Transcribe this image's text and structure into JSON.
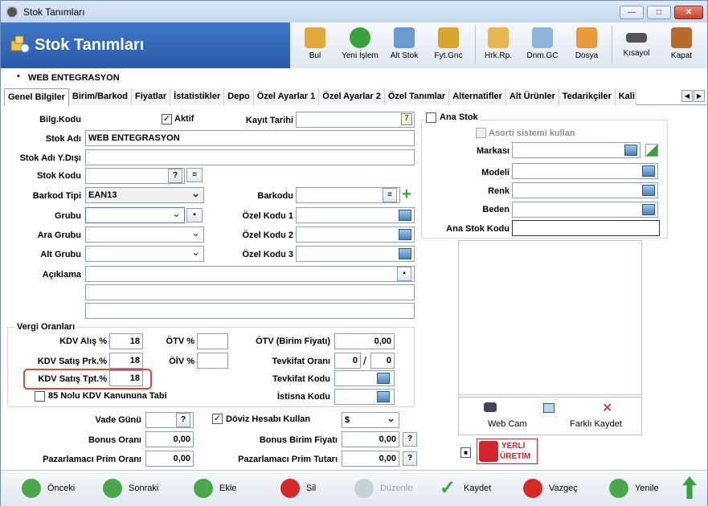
{
  "window": {
    "title": "Stok Tanımları",
    "min": "—",
    "max": "□",
    "close": "✕"
  },
  "toolbar": {
    "title": "Stok Tanımları",
    "buttons": [
      "Bul",
      "Yeni İşlem",
      "Alt Stok",
      "Fyt.Gnc",
      "Hrk.Rp.",
      "Dnm.GC",
      "Dosya",
      "Kısayol",
      "Kapat"
    ]
  },
  "subheader": {
    "label": "WEB ENTEGRASYON",
    "marker": "▪"
  },
  "tabs": [
    "Genel Bilgiler",
    "Birim/Barkod",
    "Fiyatlar",
    "İstatistikler",
    "Depo",
    "Özel Ayarlar 1",
    "Özel Ayarlar 2",
    "Özel Tanımlar",
    "Alternatifler",
    "Alt Ürünler",
    "Tedarikçiler",
    "Kali"
  ],
  "tabnav": {
    "prev": "◀",
    "next": "▶"
  },
  "form": {
    "bilg_kodu": "Bilg.Kodu",
    "aktif": "Aktif",
    "aktif_check": "✓",
    "kayit_tarihi": "Kayıt Tarihi",
    "kayit_tarihi_val": "",
    "stok_adi": "Stok Adı",
    "stok_adi_val": "WEB ENTEGRASYON",
    "stok_adi_ydisi": "Stok Adı Y.Dışı",
    "stok_kodu": "Stok Kodu",
    "q": "?",
    "barkod_tipi": "Barkod Tipi",
    "barkod_tipi_val": "EAN13",
    "barkodu": "Barkodu",
    "plus": "+",
    "grubu": "Grubu",
    "ozel_kodu_1": "Özel Kodu 1",
    "ara_grubu": "Ara Grubu",
    "ozel_kodu_2": "Özel Kodu 2",
    "alt_grubu": "Alt Grubu",
    "ozel_kodu_3": "Özel Kodu 3",
    "aciklama": "Açıklama"
  },
  "vergi": {
    "title": "Vergi Oranları",
    "kdv_alis": "KDV Alış %",
    "kdv_alis_val": "18",
    "kdv_satis_prk": "KDV Satış Prk.%",
    "kdv_satis_prk_val": "18",
    "kdv_satis_tpt": "KDV Satış Tpt.%",
    "kdv_satis_tpt_val": "18",
    "otv": "ÖTV %",
    "oiv": "ÖİV %",
    "otv_birim": "ÖTV (Birim Fiyatı)",
    "otv_birim_val": "0,00",
    "tevkifat_orani": "Tevkifat Oranı",
    "tevkifat_a": "0",
    "slash": "/",
    "tevkifat_b": "0",
    "tevkifat_kodu": "Tevkifat Kodu",
    "istisna_kodu": "İstisna Kodu",
    "kdv85": "85 Nolu KDV Kanununa Tabi"
  },
  "lower": {
    "vade_gunu": "Vade Günü",
    "doviz": "Döviz Hesabı Kullan",
    "doviz_check": "✓",
    "doviz_val": "$",
    "bonus_orani": "Bonus Oranı",
    "bonus_orani_val": "0,00",
    "bonus_birim": "Bonus Birim Fiyatı",
    "bonus_birim_val": "0,00",
    "pazarlamaci_orani": "Pazarlamacı Prim Oranı",
    "pazarlamaci_orani_val": "0,00",
    "pazarlamaci_tutari": "Pazarlamacı Prim Tutarı",
    "pazarlamaci_tutari_val": "0,00"
  },
  "right": {
    "ana_stok": "Ana Stok",
    "asorti": "Asorti sistemi kullan",
    "markasi": "Markası",
    "modeli": "Modeli",
    "renk": "Renk",
    "beden": "Beden",
    "ana_stok_kodu": "Ana Stok Kodu",
    "web_cam": "Web Cam",
    "farkli_kaydet": "Farklı Kaydet",
    "farkli_x": "✕",
    "yerli1": "YERLİ",
    "yerli2": "ÜRETİM"
  },
  "footer": [
    "Önceki",
    "Sonraki",
    "Ekle",
    "Sil",
    "Düzenle",
    "Kaydet",
    "Vazgeç",
    "Yenile"
  ],
  "colors": {
    "toolbar": "#2f66b8",
    "highlight": "#e0443a",
    "green": "#3aa23a",
    "red": "#d42a2a",
    "disabled": "#9aa3ad"
  }
}
